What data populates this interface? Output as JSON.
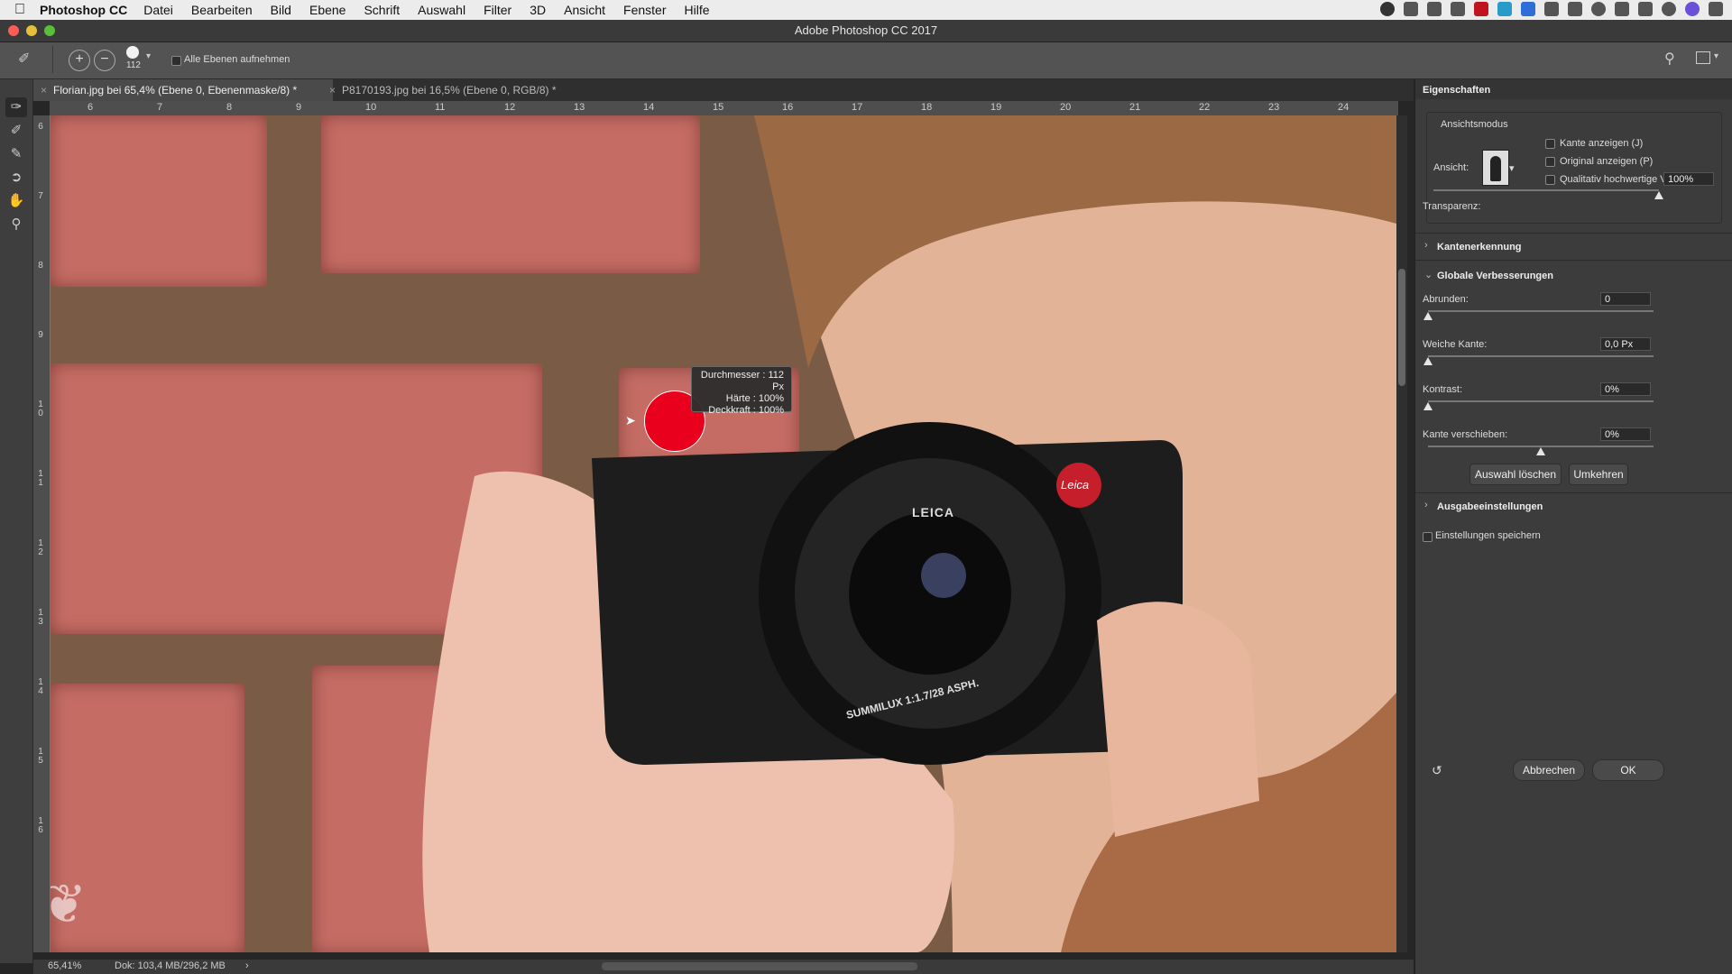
{
  "menubar": {
    "app": "Photoshop CC",
    "items": [
      "Datei",
      "Bearbeiten",
      "Bild",
      "Ebene",
      "Schrift",
      "Auswahl",
      "Filter",
      "3D",
      "Ansicht",
      "Fenster",
      "Hilfe"
    ]
  },
  "window_title": "Adobe Photoshop CC 2017",
  "options_bar": {
    "brush_size": "112",
    "sample_all_label": "Alle Ebenen aufnehmen"
  },
  "tabs": [
    {
      "label": "Florian.jpg bei 65,4% (Ebene 0, Ebenenmaske/8) *",
      "active": true
    },
    {
      "label": "P8170193.jpg bei 16,5% (Ebene 0, RGB/8) *",
      "active": false
    }
  ],
  "ruler": {
    "h_ticks": [
      "6",
      "7",
      "8",
      "9",
      "10",
      "11",
      "12",
      "13",
      "14",
      "15",
      "16",
      "17",
      "18",
      "19",
      "20",
      "21",
      "22",
      "23",
      "24"
    ],
    "v_ticks": [
      "6",
      "7",
      "8",
      "9",
      "10",
      "11",
      "12",
      "13",
      "14",
      "15",
      "16"
    ]
  },
  "brush_tooltip": {
    "diameter": "Durchmesser :  112 Px",
    "hardness": "Härte :  100%",
    "opacity": "Deckkraft :  100%"
  },
  "camera_text": {
    "brand": "LEICA",
    "badge": "Leica",
    "lens": "SUMMILUX 1:1.7/28 ASPH."
  },
  "status": {
    "zoom": "65,41%",
    "doc": "Dok: 103,4 MB/296,2 MB"
  },
  "panel": {
    "title": "Eigenschaften",
    "view_mode": {
      "section": "Ansichtsmodus",
      "view_label": "Ansicht:",
      "options": [
        "Kante anzeigen (J)",
        "Original anzeigen (P)",
        "Qualitativ hochwertige Vorschau"
      ]
    },
    "transparency": {
      "label": "Transparenz:",
      "value": "100%",
      "level": 1.0
    },
    "edge_detection": "Kantenerkennung",
    "global": {
      "title": "Globale Verbesserungen",
      "smooth": {
        "label": "Abrunden:",
        "value": "0",
        "level": 0.0
      },
      "feather": {
        "label": "Weiche Kante:",
        "value": "0,0 Px",
        "level": 0.0
      },
      "contrast": {
        "label": "Kontrast:",
        "value": "0%",
        "level": 0.0
      },
      "shift_edge": {
        "label": "Kante verschieben:",
        "value": "0%",
        "level": 0.5
      },
      "clear_button": "Auswahl löschen",
      "invert_button": "Umkehren"
    },
    "output": "Ausgabeeinstellungen",
    "remember": "Einstellungen speichern",
    "cancel": "Abbrechen",
    "ok": "OK"
  },
  "colors": {
    "brush_dot": "#e8001c",
    "panel_bg": "#3c3c3c",
    "brick": "#c56d65"
  }
}
